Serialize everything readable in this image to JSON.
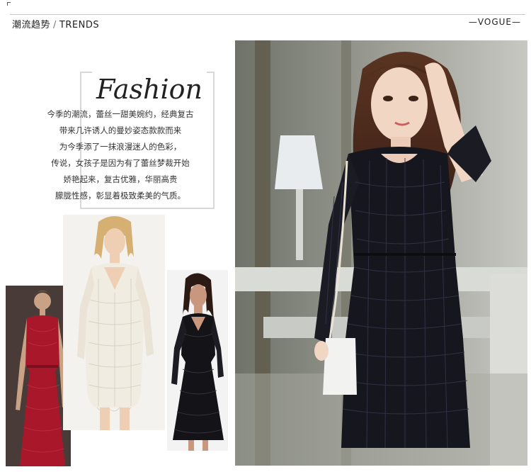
{
  "header": {
    "title_cn": "潮流趋势",
    "separator": "/",
    "title_en": "TRENDS",
    "brand": "—VOGUE—"
  },
  "fashion": {
    "title": "Fashion",
    "lines": [
      "今季的潮流，蕾丝一甜美婉约，经典复古",
      "带来几许诱人的曼妙姿态款款而来",
      "为今季添了一抹浪漫迷人的色彩，",
      "传说，女孩子是因为有了蕾丝梦裁开始",
      "娇艳起来，复古优雅，华丽高贵",
      "朦胧性感，彰显着极致柔美的气质。"
    ]
  },
  "photos": {
    "red_dress": "red-lace-dress-photo",
    "white_dress": "white-lace-dress-photo",
    "black_dress": "black-lace-dress-photo",
    "main": "model-black-lace-dress-photo"
  },
  "colors": {
    "red_dress": "#a8182a",
    "white_dress": "#f1ece2",
    "black_dress": "#141418",
    "main_dress": "#16161e",
    "main_background": "#8a8c84"
  }
}
